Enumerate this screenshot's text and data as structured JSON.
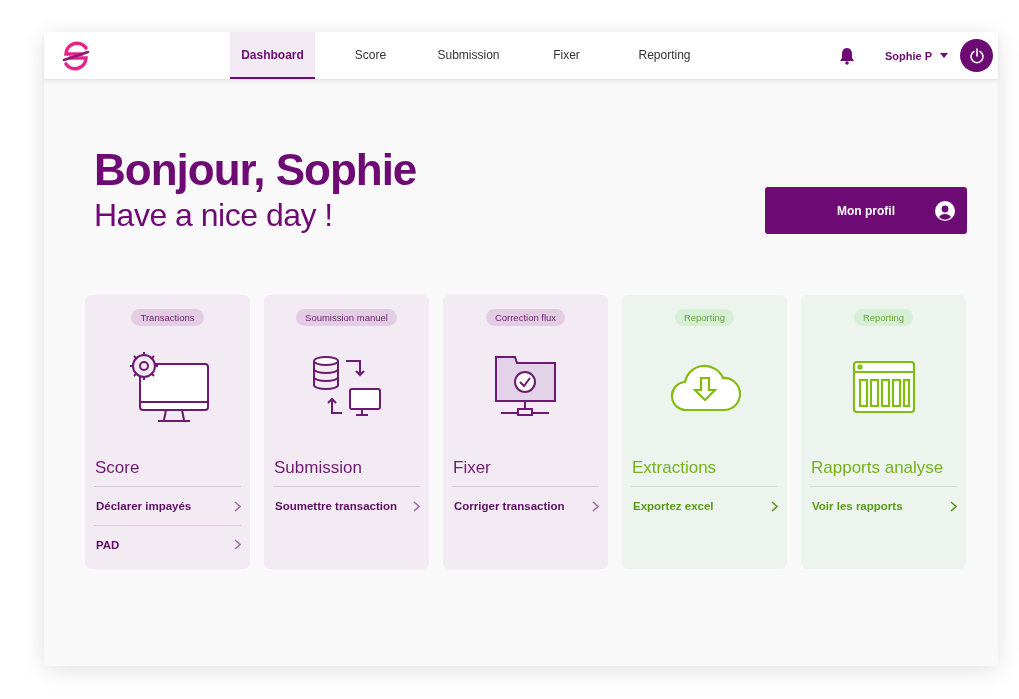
{
  "nav": {
    "tabs": [
      {
        "label": "Dashboard",
        "selected": true
      },
      {
        "label": "Score",
        "selected": false
      },
      {
        "label": "Submission",
        "selected": false
      },
      {
        "label": "Fixer",
        "selected": false
      },
      {
        "label": "Reporting",
        "selected": false
      }
    ],
    "user": "Sophie P"
  },
  "hero": {
    "greeting": "Bonjour, Sophie",
    "subtitle": "Have a nice day !",
    "profile_button": "Mon profil"
  },
  "cards": [
    {
      "kind": "transactions",
      "tag": "Transactions",
      "title": "Score",
      "links": [
        "Déclarer impayés",
        "PAD"
      ]
    },
    {
      "kind": "transactions",
      "tag": "Soumission manuel",
      "title": "Submission",
      "links": [
        "Soumettre transaction"
      ]
    },
    {
      "kind": "transactions",
      "tag": "Correction flux",
      "title": "Fixer",
      "links": [
        "Corriger transaction"
      ]
    },
    {
      "kind": "reporting",
      "tag": "Reporting",
      "title": "Extractions",
      "links": [
        "Exportez excel"
      ]
    },
    {
      "kind": "reporting",
      "tag": "Reporting",
      "title": "Rapports analyse",
      "links": [
        "Voir les rapports"
      ]
    }
  ]
}
